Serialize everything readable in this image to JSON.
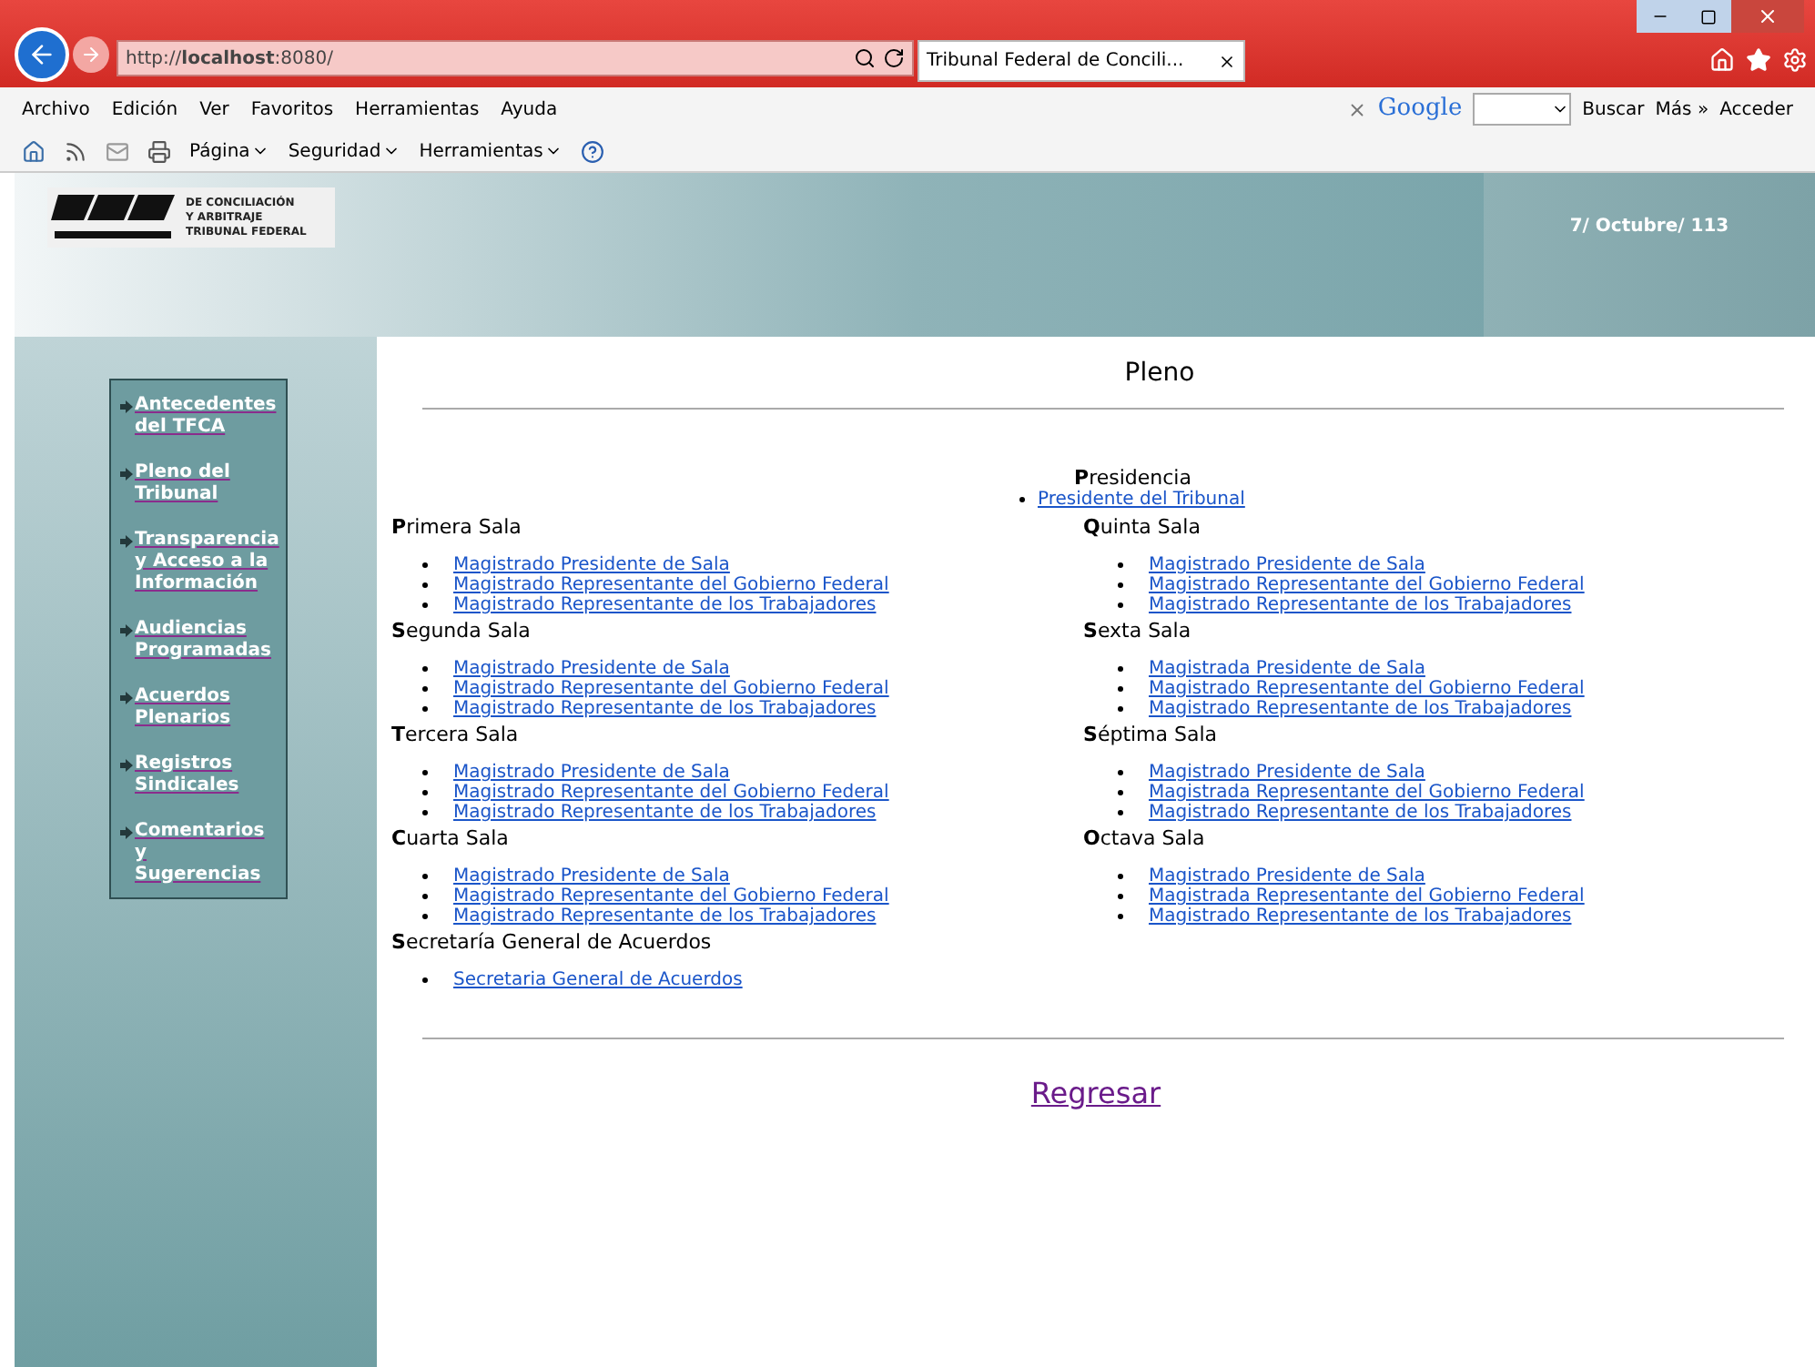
{
  "browser": {
    "address": "http://**localhost**:8080/",
    "tab_title": "Tribunal Federal de Concili...",
    "menu": [
      "Archivo",
      "Edición",
      "Ver",
      "Favoritos",
      "Herramientas",
      "Ayuda"
    ],
    "search_brand": "Google",
    "search_button": "Buscar",
    "more": "Más »",
    "sign_in": "Acceder",
    "commands": [
      "Página",
      "Seguridad",
      "Herramientas"
    ]
  },
  "header": {
    "logo_lines": [
      "DE CONCILIACIÓN",
      "Y ARBITRAJE",
      "TRIBUNAL FEDERAL"
    ],
    "date": "7/ Octubre/ 113"
  },
  "sidebar": {
    "items": [
      "Antecedentes del TFCA",
      "Pleno del Tribunal",
      "Transparencia y Acceso a la Información",
      "Audiencias Programadas",
      "Acuerdos Plenarios",
      "Registros Sindicales",
      "Comentarios y Sugerencias"
    ]
  },
  "page": {
    "title": "Pleno",
    "presidency": {
      "heading": "**P**residencia",
      "links": [
        "Presidente del Tribunal"
      ]
    },
    "left": [
      {
        "heading": "**P**rimera Sala",
        "links": [
          "Magistrado Presidente de Sala",
          "Magistrado Representante del Gobierno Federal",
          "Magistrado Representante de los Trabajadores"
        ]
      },
      {
        "heading": "**S**egunda Sala",
        "links": [
          "Magistrado Presidente de Sala",
          "Magistrado Representante del Gobierno Federal",
          "Magistrado Representante de los Trabajadores"
        ]
      },
      {
        "heading": "**T**ercera Sala",
        "links": [
          "Magistrado Presidente de Sala",
          "Magistrado Representante del Gobierno Federal",
          "Magistrado Representante de los Trabajadores"
        ]
      },
      {
        "heading": "**C**uarta Sala",
        "links": [
          "Magistrado Presidente de Sala",
          "Magistrado Representante del Gobierno Federal",
          "Magistrado Representante de los Trabajadores"
        ]
      },
      {
        "heading": "**S**ecretaría General de Acuerdos",
        "links": [
          "Secretaria General de Acuerdos"
        ]
      }
    ],
    "right": [
      {
        "heading": "**Q**uinta Sala",
        "links": [
          "Magistrado Presidente de Sala",
          "Magistrado Representante del Gobierno Federal",
          "Magistrado Representante de los Trabajadores"
        ]
      },
      {
        "heading": "**S**exta Sala",
        "links": [
          "Magistrada Presidente de Sala",
          "Magistrado Representante del Gobierno Federal",
          "Magistrado Representante de los Trabajadores"
        ]
      },
      {
        "heading": "**S**éptima Sala",
        "links": [
          "Magistrado Presidente de Sala",
          "Magistrada Representante del Gobierno Federal",
          "Magistrado Representante de los Trabajadores"
        ]
      },
      {
        "heading": "**O**ctava Sala",
        "links": [
          "Magistrado Presidente de Sala",
          "Magistrada Representante del Gobierno Federal",
          "Magistrado Representante de los Trabajadores"
        ]
      }
    ],
    "back_link": "Regresar"
  }
}
